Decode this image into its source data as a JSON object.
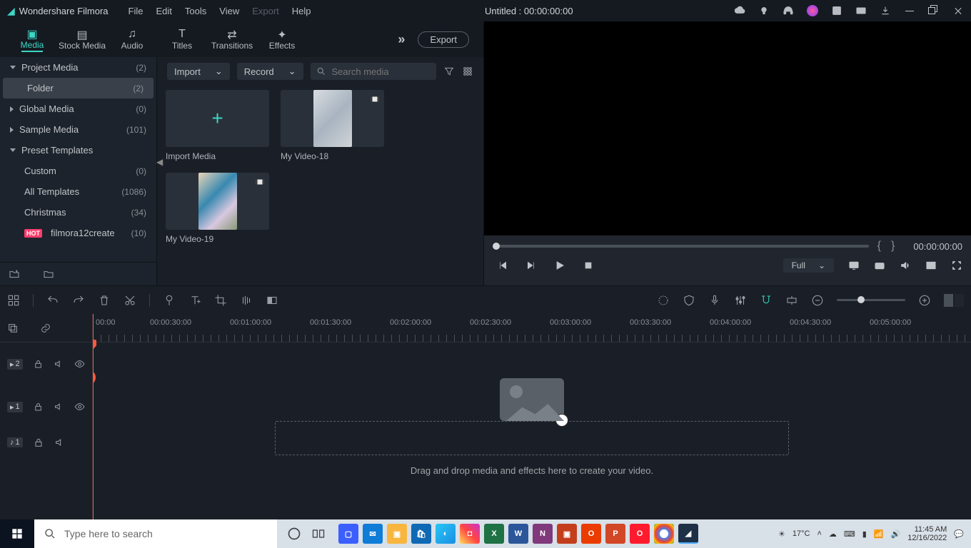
{
  "titlebar": {
    "appname": "Wondershare Filmora",
    "menus": {
      "file": "File",
      "edit": "Edit",
      "tools": "Tools",
      "view": "View",
      "export": "Export",
      "help": "Help"
    },
    "doc_title": "Untitled : 00:00:00:00"
  },
  "tabs": {
    "media": "Media",
    "stock": "Stock Media",
    "audio": "Audio",
    "titles": "Titles",
    "transitions": "Transitions",
    "effects": "Effects",
    "export_btn": "Export"
  },
  "sidebar": {
    "items": [
      {
        "label": "Project Media",
        "count": "(2)"
      },
      {
        "label": "Folder",
        "count": "(2)"
      },
      {
        "label": "Global Media",
        "count": "(0)"
      },
      {
        "label": "Sample Media",
        "count": "(101)"
      },
      {
        "label": "Preset Templates",
        "count": ""
      },
      {
        "label": "Custom",
        "count": "(0)"
      },
      {
        "label": "All Templates",
        "count": "(1086)"
      },
      {
        "label": "Christmas",
        "count": "(34)"
      },
      {
        "label": "filmora12create",
        "count": "(10)"
      }
    ]
  },
  "toolbar": {
    "import": "Import",
    "record": "Record",
    "search_placeholder": "Search media"
  },
  "media": {
    "import_label": "Import Media",
    "clip1": "My Video-18",
    "clip2": "My Video-19"
  },
  "preview": {
    "timecode": "00:00:00:00",
    "quality": "Full"
  },
  "timeline": {
    "ruler": [
      "00:00",
      "00:00:30:00",
      "00:01:00:00",
      "00:01:30:00",
      "00:02:00:00",
      "00:02:30:00",
      "00:03:00:00",
      "00:03:30:00",
      "00:04:00:00",
      "00:04:30:00",
      "00:05:00:00"
    ],
    "tracks": {
      "v2": "2",
      "v1": "1",
      "a1": "1"
    },
    "drop_hint": "Drag and drop media and effects here to create your video."
  },
  "taskbar": {
    "search_placeholder": "Type here to search",
    "temp": "17°C",
    "time": "11:45 AM",
    "date": "12/16/2022"
  }
}
